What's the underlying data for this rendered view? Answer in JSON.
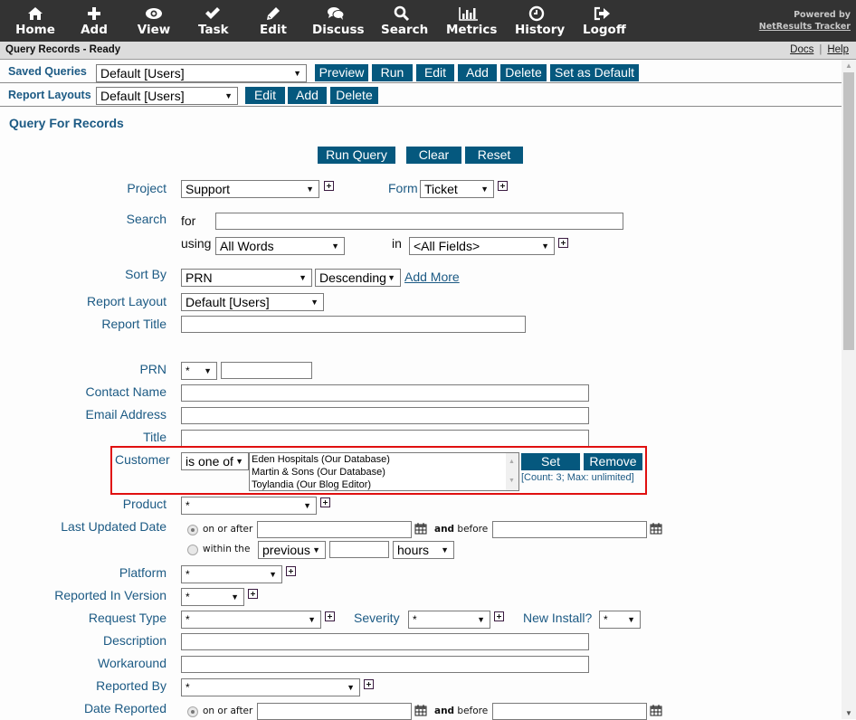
{
  "topnav": {
    "items": [
      {
        "label": "Home",
        "icon": "home-icon"
      },
      {
        "label": "Add",
        "icon": "plus-icon"
      },
      {
        "label": "View",
        "icon": "eye-icon"
      },
      {
        "label": "Task",
        "icon": "checkmark-icon"
      },
      {
        "label": "Edit",
        "icon": "pencil-icon"
      },
      {
        "label": "Discuss",
        "icon": "chat-bubbles-icon"
      },
      {
        "label": "Search",
        "icon": "magnifier-icon"
      },
      {
        "label": "Metrics",
        "icon": "bar-chart-icon"
      },
      {
        "label": "History",
        "icon": "clock-icon"
      },
      {
        "label": "Logoff",
        "icon": "logout-icon"
      }
    ],
    "powered_by": "Powered by",
    "brand_link": "NetResults Tracker"
  },
  "statusbar": {
    "title": "Query Records - Ready",
    "docs": "Docs",
    "separator": "|",
    "help": "Help"
  },
  "saved_queries": {
    "label": "Saved Queries",
    "selected": "Default [Users]",
    "buttons": [
      "Preview",
      "Run",
      "Edit",
      "Add",
      "Delete",
      "Set as Default"
    ]
  },
  "report_layouts": {
    "label": "Report Layouts",
    "selected": "Default [Users]",
    "buttons": [
      "Edit",
      "Add",
      "Delete"
    ]
  },
  "form": {
    "title": "Query For Records",
    "actions": [
      "Run Query",
      "Clear",
      "Reset"
    ],
    "project": {
      "label": "Project",
      "value": "Support"
    },
    "form_field": {
      "label": "Form",
      "value": "Ticket"
    },
    "search": {
      "label": "Search",
      "for_label": "for",
      "for_value": "",
      "using_label": "using",
      "using_value": "All Words",
      "in_label": "in",
      "in_value": "<All Fields>"
    },
    "sort_by": {
      "label": "Sort By",
      "field": "PRN",
      "order": "Descending",
      "add_more": "Add More"
    },
    "report_layout": {
      "label": "Report Layout",
      "value": "Default [Users]"
    },
    "report_title": {
      "label": "Report Title",
      "value": ""
    },
    "prn": {
      "label": "PRN",
      "operator": "*",
      "value": ""
    },
    "contact_name": {
      "label": "Contact Name",
      "value": ""
    },
    "email_address": {
      "label": "Email Address",
      "value": ""
    },
    "title_field": {
      "label": "Title",
      "value": ""
    },
    "customer": {
      "label": "Customer",
      "operator": "is one of",
      "options": [
        "Eden Hospitals (Our Database)",
        "Martin & Sons (Our Database)",
        "Toylandia (Our Blog Editor)"
      ],
      "set_label": "Set",
      "remove_label": "Remove",
      "count_note": "[Count: 3; Max: unlimited]",
      "highlight_color": "#e01010"
    },
    "product": {
      "label": "Product",
      "value": "*"
    },
    "last_updated": {
      "label": "Last Updated Date",
      "on_or_after": "on or after",
      "and": "and",
      "before": "before",
      "within_the": "within the",
      "relative": "previous",
      "amount": "",
      "unit": "hours",
      "selected_mode": "on or after"
    },
    "platform": {
      "label": "Platform",
      "value": "*"
    },
    "reported_in_version": {
      "label": "Reported In Version",
      "value": "*"
    },
    "request_type": {
      "label": "Request Type",
      "value": "*"
    },
    "severity": {
      "label": "Severity",
      "value": "*"
    },
    "new_install": {
      "label": "New Install?",
      "value": "*"
    },
    "description": {
      "label": "Description",
      "value": ""
    },
    "workaround": {
      "label": "Workaround",
      "value": ""
    },
    "reported_by": {
      "label": "Reported By",
      "value": "*"
    },
    "date_reported": {
      "label": "Date Reported",
      "on_or_after": "on or after",
      "and": "and",
      "before": "before"
    }
  },
  "colors": {
    "nav_bg": "#333333",
    "button_bg": "#05587e",
    "label_color": "#1c5a84"
  }
}
